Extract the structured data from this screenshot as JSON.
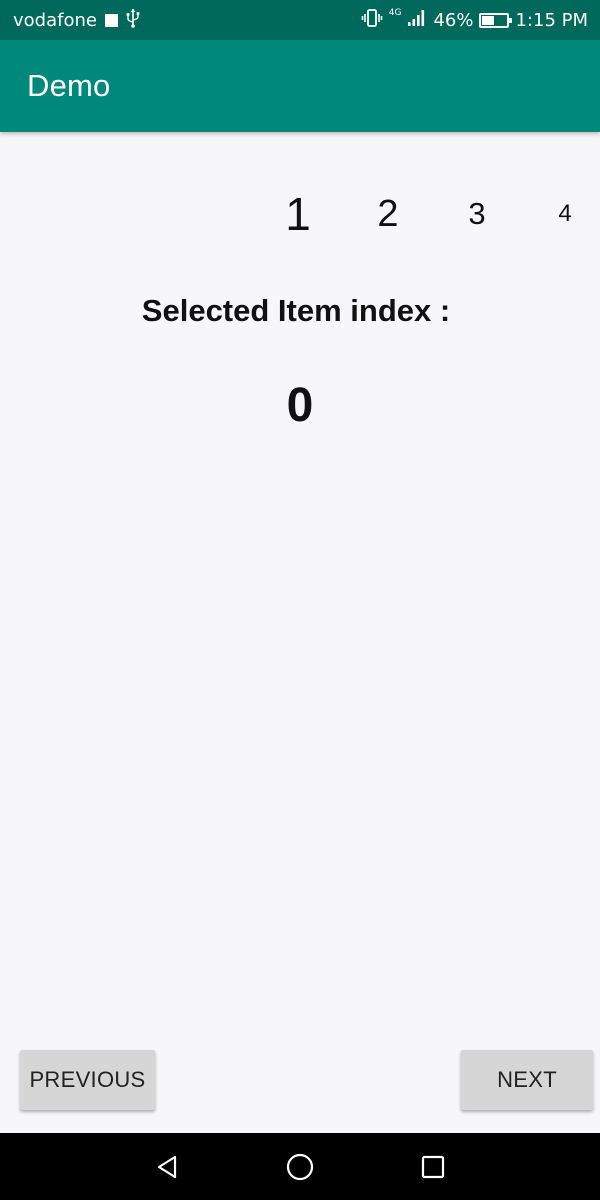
{
  "status_bar": {
    "carrier": "vodafone",
    "network_label": "4G",
    "battery_percent_text": "46%",
    "battery_level": 0.46,
    "time": "1:15 PM",
    "icons": [
      "notification-square-icon",
      "usb-icon",
      "vibrate-icon",
      "signal-icon",
      "battery-charging-icon"
    ]
  },
  "app_bar": {
    "title": "Demo",
    "color": "#00897b",
    "status_color": "#00695c"
  },
  "picker": {
    "items": [
      "1",
      "2",
      "3",
      "4"
    ],
    "selected_index": 0
  },
  "selection": {
    "label": "Selected Item index :",
    "value": "0"
  },
  "buttons": {
    "previous_label": "PREVIOUS",
    "next_label": "NEXT"
  },
  "nav_bar": {
    "icons": [
      "back-icon",
      "home-icon",
      "recents-icon"
    ]
  }
}
